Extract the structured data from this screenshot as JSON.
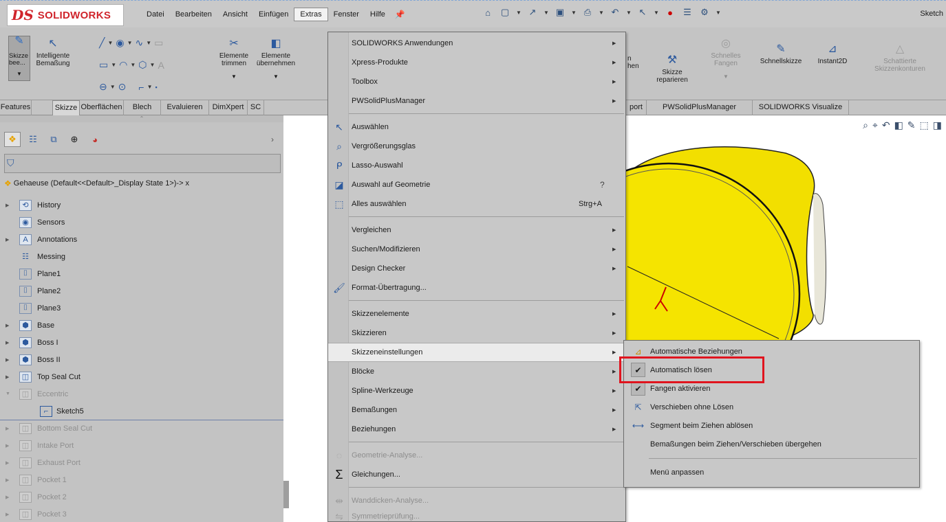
{
  "app": {
    "logo_ds": "DS",
    "logo_text": "SOLIDWORKS",
    "window_title": "Sketch"
  },
  "menubar": {
    "items": [
      "Datei",
      "Bearbeiten",
      "Ansicht",
      "Einfügen",
      "Extras",
      "Fenster",
      "Hilfe"
    ],
    "active": "Extras"
  },
  "ribbon": {
    "skizze_button": "Skizze bee...",
    "intelligente": "Intelligente Bemaßung",
    "elemente_trimmen": "Elemente trimmen",
    "elemente_uebernehmen": "Elemente übernehmen",
    "partial_left": "n\nhen",
    "skizze_reparieren": "Skizze reparieren",
    "schnelles_fangen": "Schnelles Fangen",
    "schnellskizze": "Schnellskizze",
    "instant2d": "Instant2D",
    "schattierte": "Schattierte Skizzenkonturen"
  },
  "tabs": {
    "left": [
      "Features",
      "Skizze",
      "Oberflächen",
      "Blech",
      "Evaluieren",
      "DimXpert",
      "SC"
    ],
    "right": [
      "port",
      "PWSolidPlusManager",
      "SOLIDWORKS Visualize"
    ],
    "active": "Skizze"
  },
  "feature_tree": {
    "root": "Gehaeuse  (Default<<Default>_Display State 1>)-> x",
    "items": [
      {
        "label": "History",
        "expand": true,
        "dim": false
      },
      {
        "label": "Sensors",
        "expand": false,
        "dim": false
      },
      {
        "label": "Annotations",
        "expand": true,
        "dim": false
      },
      {
        "label": "Messing",
        "expand": false,
        "dim": false
      },
      {
        "label": "Plane1",
        "expand": false,
        "dim": false
      },
      {
        "label": "Plane2",
        "expand": false,
        "dim": false
      },
      {
        "label": "Plane3",
        "expand": false,
        "dim": false
      },
      {
        "label": "Base",
        "expand": true,
        "dim": false
      },
      {
        "label": "Boss I",
        "expand": true,
        "dim": false
      },
      {
        "label": "Boss II",
        "expand": true,
        "dim": false
      },
      {
        "label": "Top Seal Cut",
        "expand": true,
        "dim": false
      },
      {
        "label": "Eccentric",
        "expand": true,
        "dim": true
      },
      {
        "label": "Sketch5",
        "expand": false,
        "dim": false,
        "child": true
      },
      {
        "label": "Bottom Seal Cut",
        "expand": true,
        "dim": true
      },
      {
        "label": "Intake Port",
        "expand": true,
        "dim": true
      },
      {
        "label": "Exhaust Port",
        "expand": true,
        "dim": true
      },
      {
        "label": "Pocket 1",
        "expand": true,
        "dim": true
      },
      {
        "label": "Pocket 2",
        "expand": true,
        "dim": true
      },
      {
        "label": "Pocket 3",
        "expand": true,
        "dim": true
      }
    ]
  },
  "extras_menu": {
    "items": [
      {
        "label": "SOLIDWORKS Anwendungen",
        "submenu": true
      },
      {
        "label": "Xpress-Produkte",
        "submenu": true
      },
      {
        "label": "Toolbox",
        "submenu": true
      },
      {
        "label": "PWSolidPlusManager",
        "submenu": true
      },
      {
        "label": "Auswählen",
        "icon": "cursor-icon"
      },
      {
        "label": "Vergrößerungsglas",
        "icon": "magnifier-icon"
      },
      {
        "label": "Lasso-Auswahl",
        "icon": "lasso-icon"
      },
      {
        "label": "Auswahl auf Geometrie",
        "icon": "geometry-select-icon",
        "extra": "help-icon"
      },
      {
        "label": "Alles auswählen",
        "icon": "select-all-icon",
        "shortcut": "Strg+A"
      },
      {
        "label": "Vergleichen",
        "submenu": true
      },
      {
        "label": "Suchen/Modifizieren",
        "submenu": true
      },
      {
        "label": "Design Checker",
        "submenu": true
      },
      {
        "label": "Format-Übertragung...",
        "icon": "format-painter-icon"
      },
      {
        "label": "Skizzenelemente",
        "submenu": true
      },
      {
        "label": "Skizzieren",
        "submenu": true
      },
      {
        "label": "Skizzeneinstellungen",
        "submenu": true,
        "highlighted": true
      },
      {
        "label": "Blöcke",
        "submenu": true
      },
      {
        "label": "Spline-Werkzeuge",
        "submenu": true
      },
      {
        "label": "Bemaßungen",
        "submenu": true
      },
      {
        "label": "Beziehungen",
        "submenu": true
      },
      {
        "label": "Geometrie-Analyse...",
        "icon": "geometry-analysis-icon",
        "disabled": true
      },
      {
        "label": "Gleichungen...",
        "icon": "sigma-icon"
      },
      {
        "label": "Wanddicken-Analyse...",
        "icon": "thickness-icon",
        "disabled": true
      },
      {
        "label": "Symmetrieprüfung...",
        "icon": "symmetry-icon",
        "disabled": true
      }
    ]
  },
  "sketch_settings_submenu": {
    "items": [
      {
        "label": "Automatische Beziehungen",
        "icon": "auto-relations-icon"
      },
      {
        "label": "Automatisch lösen",
        "checked": true
      },
      {
        "label": "Fangen aktivieren",
        "checked": true
      },
      {
        "label": "Verschieben ohne Lösen",
        "icon": "move-no-solve-icon"
      },
      {
        "label": "Segment beim Ziehen ablösen",
        "icon": "detach-segment-icon"
      },
      {
        "label": "Bemaßungen beim Ziehen/Verschieben übergehen"
      },
      {
        "label": "Menü anpassen"
      }
    ]
  },
  "colors": {
    "part_yellow": "#f5e400",
    "highlight_red": "#e0141e",
    "brand_red": "#d0242b"
  }
}
